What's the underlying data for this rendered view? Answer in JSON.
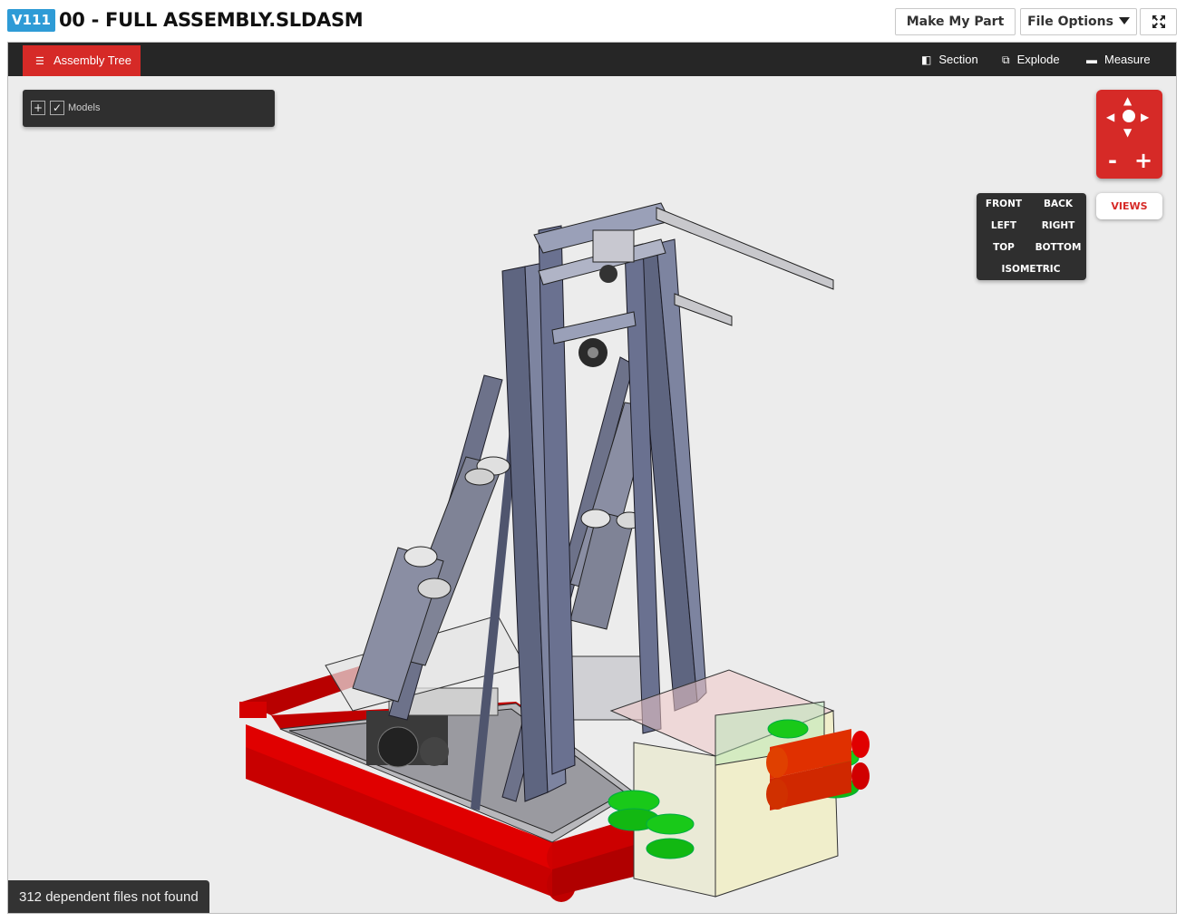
{
  "header": {
    "version": "V111",
    "title": "00 - FULL ASSEMBLY.SLDASM",
    "make_my_part_label": "Make My Part",
    "file_options_label": "File Options"
  },
  "toolbar": {
    "assembly_tree_label": "Assembly Tree",
    "section_label": "Section",
    "explode_label": "Explode",
    "measure_label": "Measure"
  },
  "models_panel": {
    "expand_symbol": "+",
    "check_symbol": "✓",
    "label": "Models"
  },
  "navigation": {
    "zoom_out": "-",
    "zoom_in": "+",
    "views_label": "VIEWS"
  },
  "views_menu": {
    "front": "FRONT",
    "back": "BACK",
    "left": "LEFT",
    "right": "RIGHT",
    "top": "TOP",
    "bottom": "BOTTOM",
    "isometric": "ISOMETRIC"
  },
  "status": {
    "message": "312 dependent files not found"
  },
  "colors": {
    "accent_red": "#d62a27",
    "version_blue": "#2e9bd6",
    "toolbar_dark": "#262626",
    "viewport_bg": "#ececec"
  }
}
